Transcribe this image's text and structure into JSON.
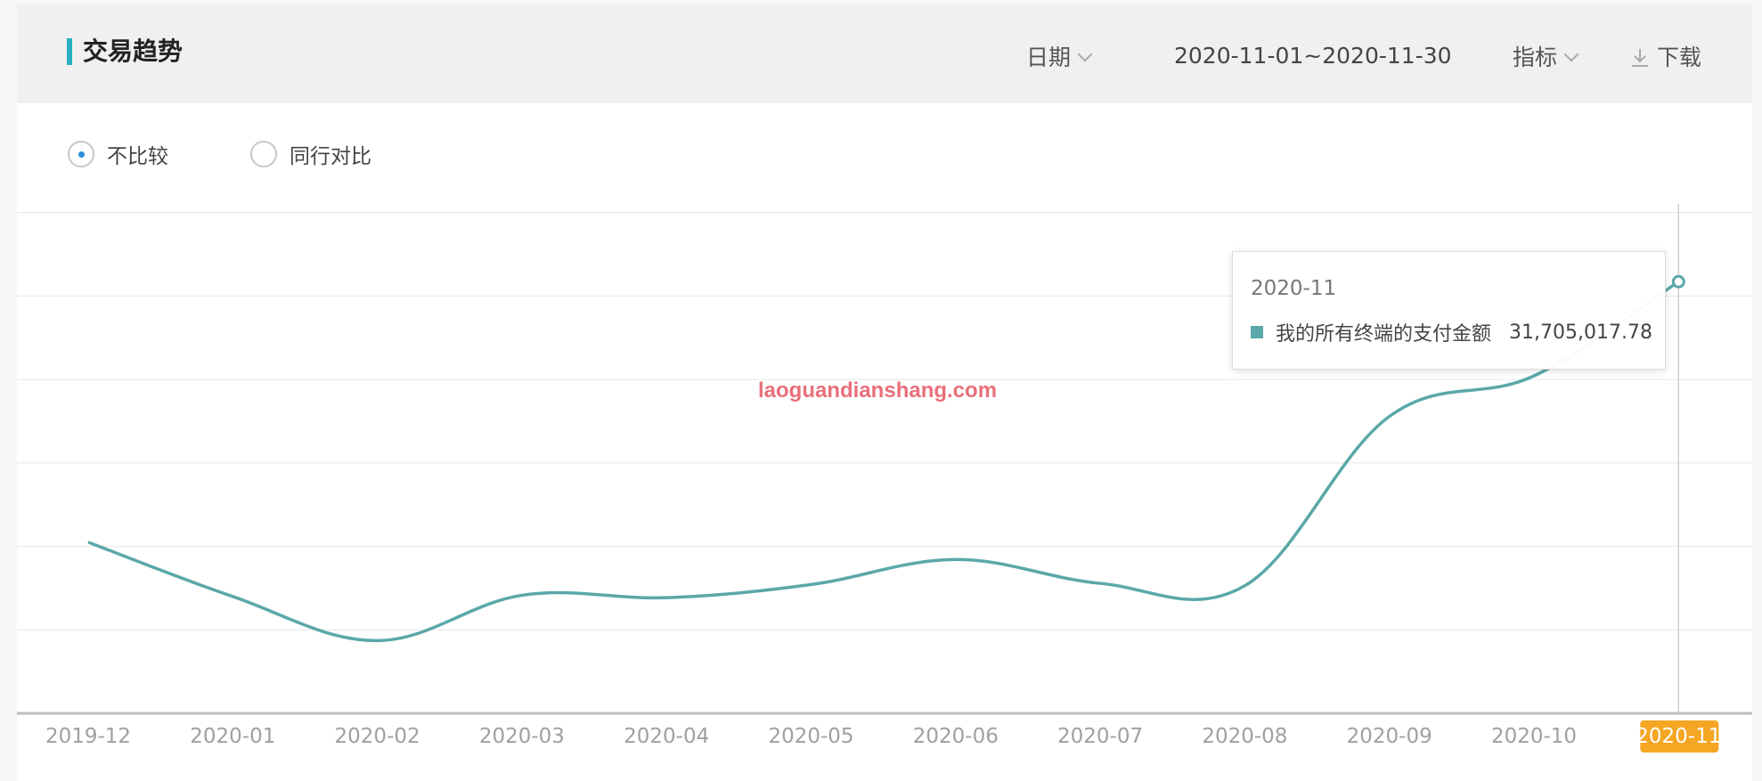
{
  "header": {
    "title": "交易趋势",
    "date_label": "日期",
    "date_range": "2020-11-01~2020-11-30",
    "metric_label": "指标",
    "download_label": "下载"
  },
  "compare": {
    "options": [
      "不比较",
      "同行对比"
    ],
    "selected": "不比较"
  },
  "watermark": "laoguandianshang.com",
  "tooltip": {
    "title": "2020-11",
    "series_name": "我的所有终端的支付金额",
    "value": "31,705,017.78"
  },
  "colors": {
    "line": "#5ba8a8",
    "accent": "#2bb1c1",
    "highlight_tick": "#f5a623"
  },
  "chart_data": {
    "type": "line",
    "x": [
      "2019-12",
      "2020-01",
      "2020-02",
      "2020-03",
      "2020-04",
      "2020-05",
      "2020-06",
      "2020-07",
      "2020-08",
      "2020-09",
      "2020-10",
      "2020-11"
    ],
    "series": [
      {
        "name": "我的所有终端的支付金额",
        "values": [
          9850000,
          5300000,
          1600000,
          5400000,
          5200000,
          6300000,
          8400000,
          6400000,
          6200000,
          20400000,
          23800000,
          31705017.78
        ]
      }
    ],
    "ylim": [
      -4500000,
      38000000
    ],
    "y_gridlines": [
      -4500000,
      2500000,
      9500000,
      16500000,
      23500000,
      30500000,
      37500000
    ],
    "grid": true,
    "highlight": "2020-11"
  }
}
